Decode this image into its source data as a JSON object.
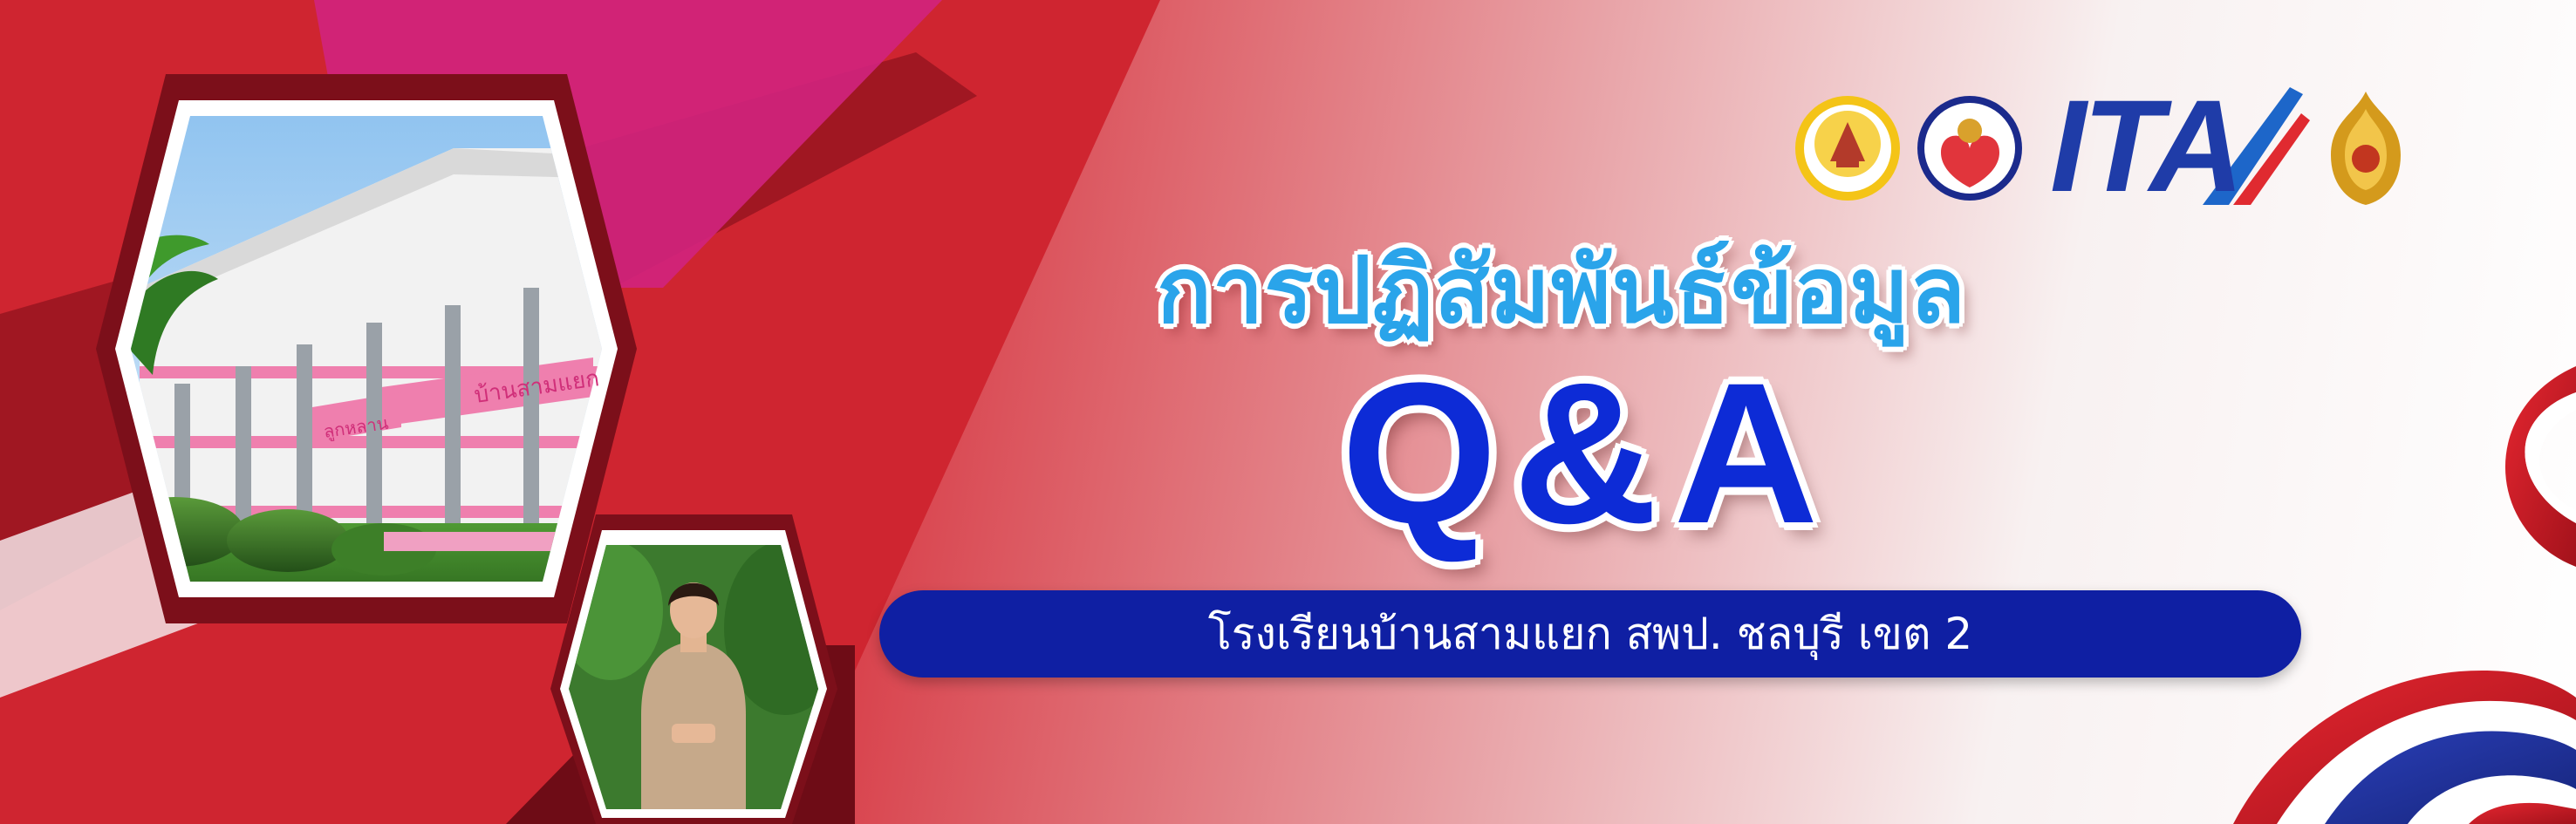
{
  "banner": {
    "title_thai": "การปฏิสัมพันธ์ข้อมูล",
    "title_qa": "Q&A",
    "school_name": "โรงเรียนบ้านสามแยก สพป. ชลบุรี เขต 2"
  },
  "logos": {
    "ita": "ITA",
    "school_seal": "school-seal-icon",
    "office_emblem": "obec-office-emblem-icon",
    "thai_emblem": "thai-royal-emblem-icon"
  },
  "photos": {
    "building_signs": [
      "บ้านสามแยก",
      "ลูกหลาน"
    ]
  },
  "colors": {
    "red_primary": "#c41e2a",
    "dark_maroon": "#6e0c16",
    "magenta": "#d0247e",
    "title_blue": "#2aa4ea",
    "qa_blue": "#0d2bd6",
    "bar_navy": "#0f1fa3"
  }
}
